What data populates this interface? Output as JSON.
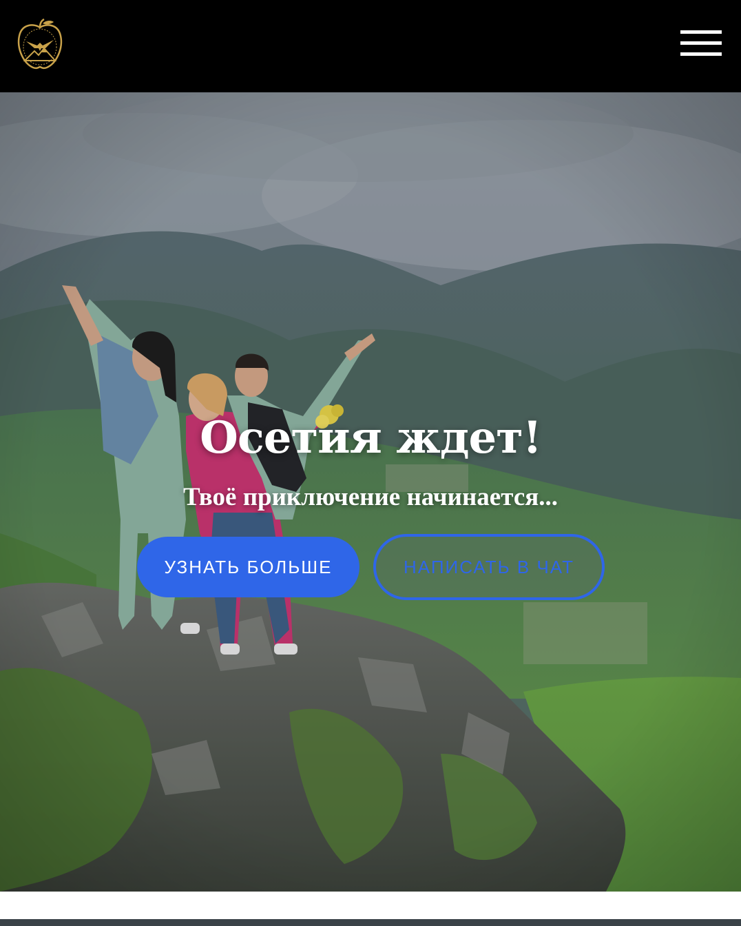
{
  "header": {
    "logo_icon": "golden-apple-eagle-mountains-logo",
    "menu_icon": "hamburger-menu-icon"
  },
  "hero": {
    "title": "Осетия ждет!",
    "subtitle": "Твоё приключение начинается...",
    "primary_button": "УЗНАТЬ БОЛЬШЕ",
    "secondary_button": "НАПИСАТЬ В ЧАТ",
    "image_description": "three women cheering on a rocky mountain ridge above a green valley under cloudy sky"
  },
  "colors": {
    "header_bg": "#000000",
    "accent_blue": "#2f66e8",
    "logo_gold": "#c9a24a",
    "text_white": "#ffffff"
  }
}
